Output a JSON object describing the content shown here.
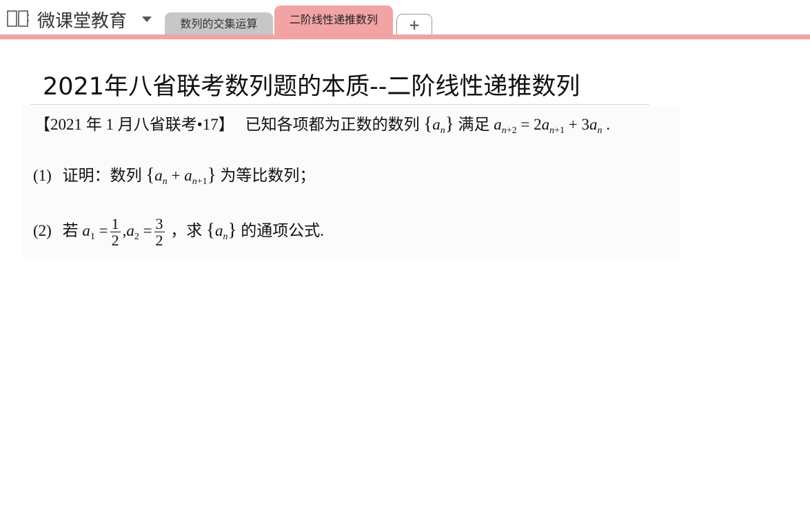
{
  "app": {
    "notebook_title": "微课堂教育",
    "tabs": [
      {
        "label": "数列的交集运算",
        "active": false
      },
      {
        "label": "二阶线性递推数列",
        "active": true
      }
    ],
    "add_tab_label": "+"
  },
  "colors": {
    "active_tab": "#f2a3a3",
    "inactive_tab": "#c7c7c7",
    "tab_strip": "#f2a3a3"
  },
  "page": {
    "title": "2021年八省联考数列题的本质--二阶线性递推数列",
    "problem": {
      "source": "【2021 年 1 月八省联考•17】",
      "stem_text": "已知各项都为正数的数列",
      "stem_seq": "{a_n}",
      "stem_text2": "满足",
      "stem_formula": "a_{n+2} = 2a_{n+1} + 3a_n .",
      "part1_label": "(1)",
      "part1_text": "证明：数列",
      "part1_seq": "{a_n + a_{n+1}}",
      "part1_text2": "为等比数列；",
      "part2_label": "(2)",
      "part2_text": "若",
      "part2_condition": "a_1 = 1/2, a_2 = 3/2",
      "part2_frac1_num": "1",
      "part2_frac1_den": "2",
      "part2_frac2_num": "3",
      "part2_frac2_den": "2",
      "part2_text2": "，求",
      "part2_seq": "{a_n}",
      "part2_text3": "的通项公式."
    }
  }
}
